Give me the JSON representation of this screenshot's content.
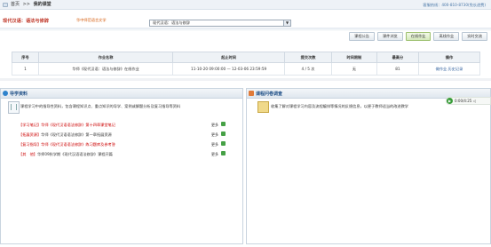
{
  "header": {
    "breadcrumb": [
      "首页",
      ">>",
      "我的课堂"
    ],
    "hotline": "客服热线：400-810-8730(免长途费)"
  },
  "course": {
    "title": "现代汉语：语法与修辞",
    "subtitle": "华中师范语言文学",
    "selected": "现代汉语：语法与修辞"
  },
  "tabs": [
    {
      "label": "课程公告",
      "active": false
    },
    {
      "label": "课件浏览",
      "active": false
    },
    {
      "label": "在线作业",
      "active": true
    },
    {
      "label": "离线作业",
      "active": false
    },
    {
      "label": "实时交流",
      "active": false
    }
  ],
  "table": {
    "headers": [
      "序号",
      "作业名称",
      "起止时间",
      "提交次数",
      "时间限制",
      "最高分",
      "操作"
    ],
    "rows": [
      {
        "index": "1",
        "name": "华师《现代汉语：语法与修辞》在线作业",
        "time": "11-10-20 09:00:00 — 12-03-06 23:59:59",
        "count": "4 / 5 次",
        "limit": "无",
        "score": "81",
        "ops": "做作业 历史记录"
      }
    ]
  },
  "player": {
    "text": "0:00/4:25  ◁ "
  },
  "left_panel": {
    "title": "导学资料",
    "description": "课程学习中的指导性资料，包含课程知识点、重点知识的导学、案例或解题分析及复习指导等资料",
    "items": [
      {
        "tag": "【学习笔记】",
        "name": "华师《现代汉语语法修辞》第十四章课堂笔记",
        "more": "更多"
      },
      {
        "tag": "【拓展资源】",
        "name": "华师《现代汉语语法修辞》第一章拓展资源",
        "more": "更多"
      },
      {
        "tag": "【复习指导】",
        "name": "华师《现代汉语语法修辞》练习题库及参考答",
        "more": "更多"
      },
      {
        "tag": "【其　他】",
        "name": "华师09秋学期《现代汉语语法修辞》课程开篇",
        "more": "更多"
      }
    ]
  },
  "right_panel": {
    "title": "课程问卷调查",
    "description": "收集了解对课程学习内容及流程编排等情况的反馈信息，以便于教师适当的改进教学"
  }
}
